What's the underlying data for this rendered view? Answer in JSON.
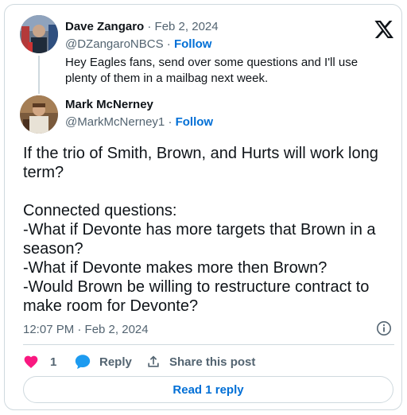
{
  "parent_tweet": {
    "author_name": "Dave Zangaro",
    "separator": "·",
    "date": "Feb 2, 2024",
    "handle": "@DZangaroNBCS",
    "follow_label": "Follow",
    "text": "Hey Eagles fans, send over some questions and I'll use plenty of them in a mailbag next week."
  },
  "reply_tweet": {
    "author_name": "Mark McNerney",
    "handle": "@MarkMcNerney1",
    "follow_label": "Follow",
    "text": "If the trio of Smith, Brown, and Hurts will work long term?\n\nConnected questions:\n-What if Devonte has more targets that Brown in a season?\n-What if Devonte makes more then Brown?\n-Would Brown be willing to restructure contract to make room for Devonte?",
    "timestamp": "12:07 PM · Feb 2, 2024"
  },
  "actions": {
    "like_count": "1",
    "reply_label": "Reply",
    "share_label": "Share this post"
  },
  "read_reply_label": "Read 1 reply",
  "icons": {
    "brand": "x-logo-icon",
    "like": "heart-icon",
    "reply": "speech-bubble-icon",
    "share": "share-arrow-icon",
    "info": "info-icon"
  },
  "colors": {
    "like": "#f91880",
    "reply": "#1d9bf0",
    "link": "#006fd6",
    "secondary_text": "#536471",
    "border": "#cfd9de"
  }
}
